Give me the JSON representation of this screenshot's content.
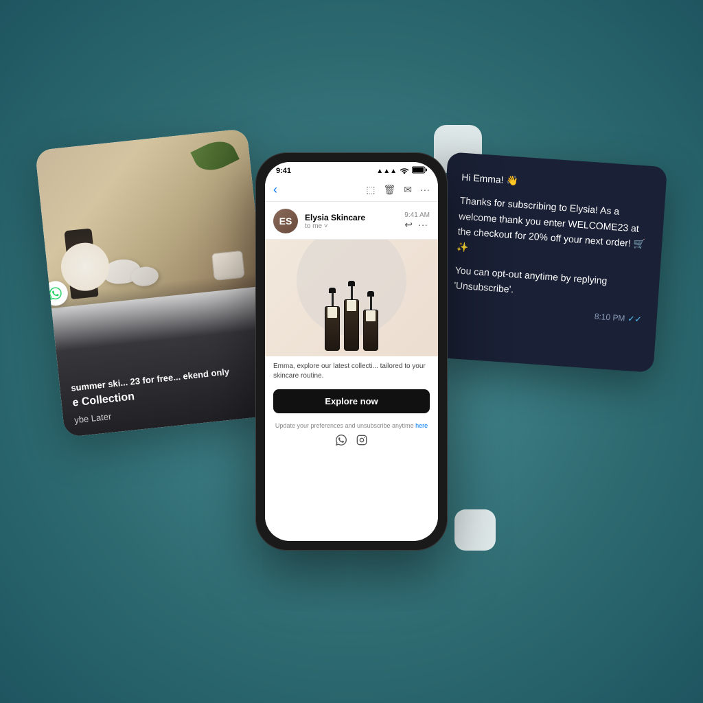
{
  "scene": {
    "background_color": "#3d7a80"
  },
  "phone": {
    "status_time": "9:41",
    "status_signal": "▲▲▲",
    "status_wifi": "WiFi",
    "status_battery": "🔋",
    "email_back": "‹",
    "toolbar_icons": [
      "⬚",
      "⬜",
      "✉",
      "···"
    ],
    "sender_avatar_text": "ES",
    "sender_name": "Elysia Skincare",
    "sender_time": "9:41 AM",
    "sender_to": "to me ˅",
    "email_desc": "Emma, explore our latest collecti... tailored to your skincare routine.",
    "explore_btn_label": "Explore now",
    "footer_text": "Update your preferences and unsubscribe anytime",
    "footer_link_text": "here",
    "social_icons": [
      "⊙",
      "⊡"
    ]
  },
  "left_card": {
    "text1": "summer ski... 23 for free... ekend only",
    "title": "e Collection",
    "btn_label": "ybe Later",
    "whatsapp_icon": "⊚"
  },
  "right_card": {
    "greeting": "Hi Emma! 👋",
    "line1": "Thanks for subscribing to Elysia! As a welcome thank you enter WELCOME23 at the checkout for 20% off your next order! 🛒✨",
    "line2": "You can opt-out anytime by replying 'Unsubscribe'.",
    "time": "8:10 PM",
    "checkmarks": "✓✓"
  },
  "decorative": {
    "square1_visible": true,
    "square2_visible": true
  }
}
